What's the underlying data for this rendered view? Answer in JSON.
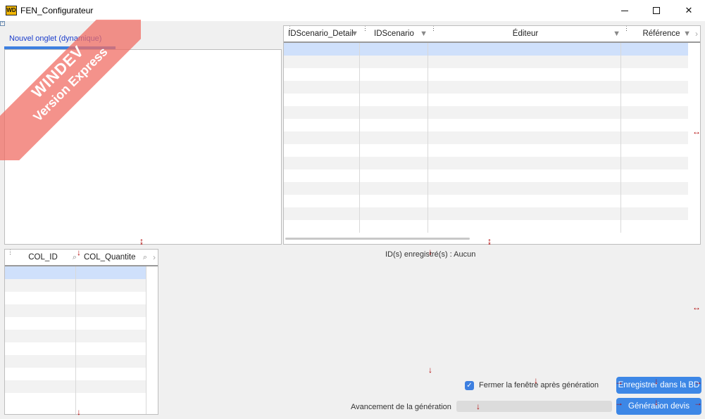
{
  "window": {
    "app_icon": "WD",
    "title": "FEN_Configurateur",
    "minimize_icon": "minimize-icon",
    "maximize_icon": "maximize-icon",
    "close_icon": "close-icon"
  },
  "tab": {
    "label": "Nouvel onglet (dynamique)"
  },
  "watermark": {
    "line1": "WINDEV",
    "line2": "Version Express"
  },
  "scenario_grid": {
    "columns": [
      {
        "label": "IDScenario_Detail",
        "icon": "filter-icon"
      },
      {
        "label": "IDScenario",
        "icon": "filter-icon"
      },
      {
        "label": "Éditeur",
        "icon": "filter-icon"
      },
      {
        "label": "Référence",
        "icon": "filter-icon"
      }
    ],
    "more_icon": "chevron-right-icon"
  },
  "col_grid": {
    "columns": [
      {
        "label": "COL_ID",
        "icon": "search-icon"
      },
      {
        "label": "COL_Quantite",
        "icon": "search-icon"
      }
    ],
    "more_icon": "chevron-right-icon"
  },
  "status": {
    "ids_saved": "ID(s) enregistré(s) : Aucun"
  },
  "options": {
    "close_after_generation": "Fermer la fenêtre après génération",
    "close_after_generation_checked": true
  },
  "buttons": {
    "save_db": "Enregistrer dans la BD",
    "generate_quote": "Génération devis"
  },
  "progress": {
    "label": "Avancement de la génération",
    "value": 0
  }
}
